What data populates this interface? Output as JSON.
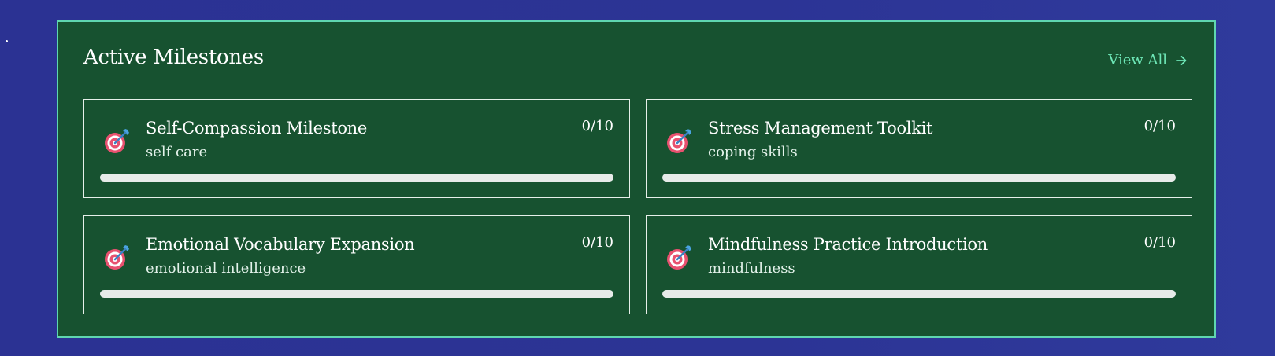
{
  "panel": {
    "title": "Active Milestones",
    "view_all_label": "View All"
  },
  "milestones": [
    {
      "title": "Self-Compassion Milestone",
      "category": "self care",
      "count": "0/10",
      "progress": 0,
      "icon": "target-icon"
    },
    {
      "title": "Stress Management Toolkit",
      "category": "coping skills",
      "count": "0/10",
      "progress": 0,
      "icon": "target-icon"
    },
    {
      "title": "Emotional Vocabulary Expansion",
      "category": "emotional intelligence",
      "count": "0/10",
      "progress": 0,
      "icon": "target-icon"
    },
    {
      "title": "Mindfulness Practice Introduction",
      "category": "mindfulness",
      "count": "0/10",
      "progress": 0,
      "icon": "target-icon"
    }
  ],
  "colors": {
    "background": "#2b3293",
    "panel": "#175230",
    "panel_border": "#5fd6b0",
    "accent": "#6ee7b7",
    "progress_track": "#e7ebe9"
  }
}
